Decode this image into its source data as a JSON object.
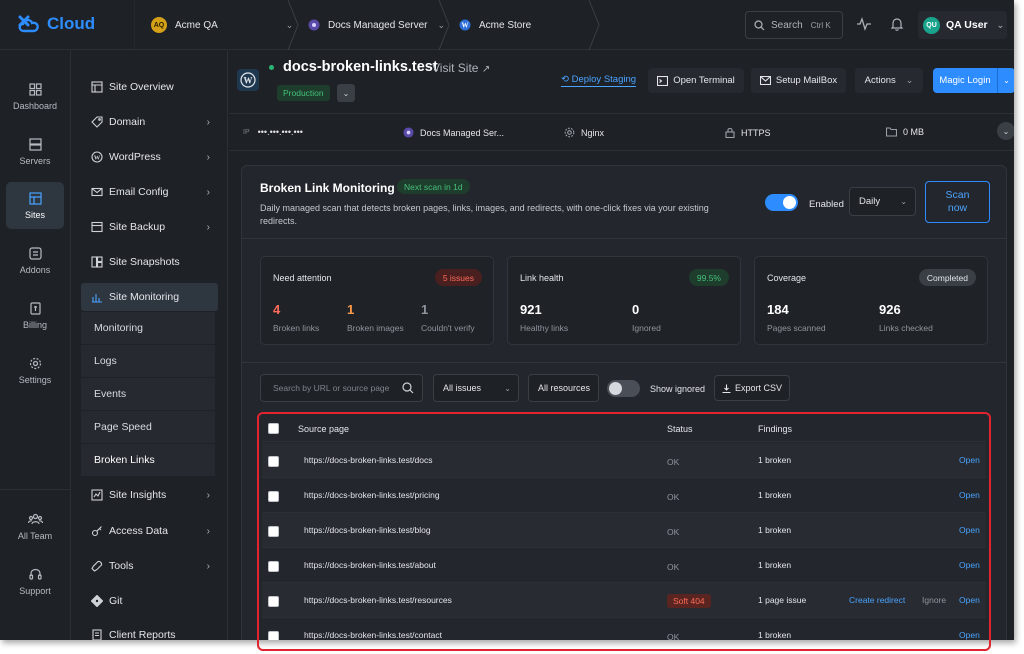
{
  "brand": {
    "name": "Cloud",
    "color": "#2d8cff"
  },
  "breadcrumbs": [
    {
      "badge": "AQ",
      "label": "Acme QA"
    },
    {
      "label": "Docs Managed Server",
      "icon": "server-dot-icon"
    },
    {
      "label": "Acme Store",
      "icon": "wordpress-icon"
    }
  ],
  "topbar": {
    "search_label": "Search",
    "search_shortcut": "Ctrl K",
    "user_initials": "QU",
    "user_name": "QA User"
  },
  "rail": [
    {
      "label": "Dashboard",
      "icon": "grid-icon"
    },
    {
      "label": "Servers",
      "icon": "server-icon"
    },
    {
      "label": "Sites",
      "icon": "sites-icon",
      "active": true
    },
    {
      "label": "Addons",
      "icon": "addons-icon"
    },
    {
      "label": "Billing",
      "icon": "billing-icon"
    },
    {
      "label": "Settings",
      "icon": "gear-icon"
    },
    {
      "label": "All Team",
      "icon": "team-icon"
    },
    {
      "label": "Support",
      "icon": "headset-icon"
    }
  ],
  "subnav": {
    "items": [
      {
        "label": "Site Overview"
      },
      {
        "label": "Domain"
      },
      {
        "label": "WordPress"
      },
      {
        "label": "Email Config"
      },
      {
        "label": "Site Backup"
      },
      {
        "label": "Site Snapshots"
      },
      {
        "label": "Site Monitoring"
      },
      {
        "label": "Site Insights"
      },
      {
        "label": "Access Data"
      },
      {
        "label": "Tools"
      },
      {
        "label": "Git"
      },
      {
        "label": "Client Reports"
      }
    ],
    "monitoring_children": [
      "Monitoring",
      "Logs",
      "Events",
      "Page Speed",
      "Broken Links"
    ]
  },
  "site": {
    "name": "docs-broken-links.test",
    "visit_label": "Visit Site",
    "environment": "Production",
    "deploy_label": "Deploy Staging",
    "terminal_label": "Open Terminal",
    "mailbox_label": "Setup MailBox",
    "actions_label": "Actions",
    "magic_login_label": "Magic Login",
    "info": {
      "ip_prefix": "IP",
      "ip": "•••.•••.•••.•••",
      "server": "Docs Managed Ser...",
      "web_server": "Nginx",
      "protocol": "HTTPS",
      "storage": "0 MB"
    }
  },
  "monitor": {
    "title": "Broken Link Monitoring",
    "next_scan": "Next scan in 1d",
    "description": "Daily managed scan that detects broken pages, links, images, and redirects, with one-click fixes via your existing redirects.",
    "enabled_label": "Enabled",
    "frequency": "Daily",
    "scan_button": "Scan now",
    "stats": {
      "attention": {
        "title": "Need attention",
        "badge": "5 issues",
        "broken_links": "4",
        "broken_links_label": "Broken links",
        "broken_images": "1",
        "broken_images_label": "Broken images",
        "unverified": "1",
        "unverified_label": "Couldn't verify"
      },
      "health": {
        "title": "Link health",
        "badge": "99.5%",
        "healthy": "921",
        "healthy_label": "Healthy links",
        "ignored": "0",
        "ignored_label": "Ignored"
      },
      "coverage": {
        "title": "Coverage",
        "badge": "Completed",
        "pages": "184",
        "pages_label": "Pages scanned",
        "links": "926",
        "links_label": "Links checked"
      }
    },
    "filters": {
      "search_placeholder": "Search by URL or source page",
      "issues": "All issues",
      "resources": "All resources",
      "show_ignored_label": "Show ignored",
      "export_label": "Export CSV"
    },
    "table": {
      "headers": {
        "source": "Source page",
        "status": "Status",
        "findings": "Findings"
      },
      "rows": [
        {
          "url": "https://docs-broken-links.test/docs",
          "status": "OK",
          "findings": "1 broken",
          "action": "Open"
        },
        {
          "url": "https://docs-broken-links.test/pricing",
          "status": "OK",
          "findings": "1 broken",
          "action": "Open"
        },
        {
          "url": "https://docs-broken-links.test/blog",
          "status": "OK",
          "findings": "1 broken",
          "action": "Open"
        },
        {
          "url": "https://docs-broken-links.test/about",
          "status": "OK",
          "findings": "1 broken",
          "action": "Open"
        },
        {
          "url": "https://docs-broken-links.test/resources",
          "status": "Soft 404",
          "findings": "1 page issue",
          "redirect": "Create redirect",
          "ignore": "Ignore",
          "action": "Open"
        },
        {
          "url": "https://docs-broken-links.test/contact",
          "status": "OK",
          "findings": "1 broken",
          "action": "Open"
        }
      ]
    }
  }
}
